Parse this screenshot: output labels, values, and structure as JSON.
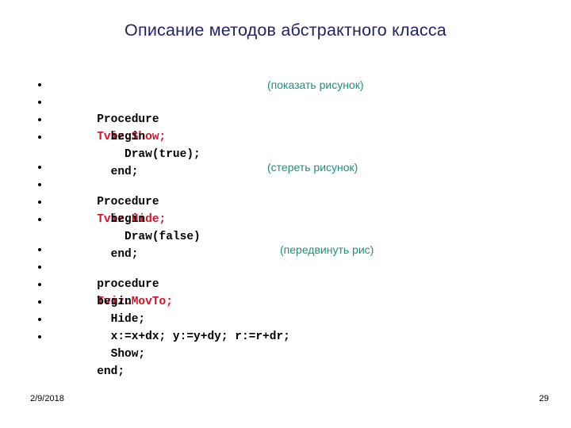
{
  "slide": {
    "title": "Описание методов абстрактного класса",
    "colors": {
      "title": "#232266",
      "code": "#000000",
      "identifier": "#d81028",
      "comment": "#1f8f7d",
      "background": "#ffffff"
    }
  },
  "blocks": [
    {
      "lines": [
        {
          "bullet": "bullet-icon",
          "keyword": "Procedure ",
          "identifier": "Tviz.Show;",
          "comment": "(показать рисунок)"
        },
        {
          "bullet": "bullet-icon",
          "keyword": "  begin"
        },
        {
          "bullet": "bullet-icon",
          "keyword": "    Draw(true);"
        },
        {
          "bullet": "bullet-icon",
          "keyword": "  end;"
        }
      ]
    },
    {
      "lines": [
        {
          "bullet": "bullet-icon",
          "keyword": "Procedure ",
          "identifier": "Tviz.Hide;",
          "comment": "(стереть рисунок)"
        },
        {
          "bullet": "bullet-icon",
          "keyword": "  begin"
        },
        {
          "bullet": "bullet-icon",
          "keyword": "    Draw(false)"
        },
        {
          "bullet": "bullet-icon",
          "keyword": "  end;"
        }
      ]
    },
    {
      "lines": [
        {
          "bullet": "bullet-icon",
          "keyword": "procedure ",
          "identifier": "Tviz.MovTo;",
          "comment": "(передвинуть рис)"
        },
        {
          "bullet": "bullet-icon",
          "keyword": "begin"
        },
        {
          "bullet": "bullet-icon",
          "keyword": "  Hide;"
        },
        {
          "bullet": "bullet-icon",
          "keyword": "  x:=x+dx; y:=y+dy; r:=r+dr;"
        },
        {
          "bullet": "bullet-icon",
          "keyword": "  Show;"
        },
        {
          "bullet": "bullet-icon",
          "keyword": "end;"
        }
      ]
    }
  ],
  "footer": {
    "date": "2/9/2018",
    "page_number": "29"
  }
}
